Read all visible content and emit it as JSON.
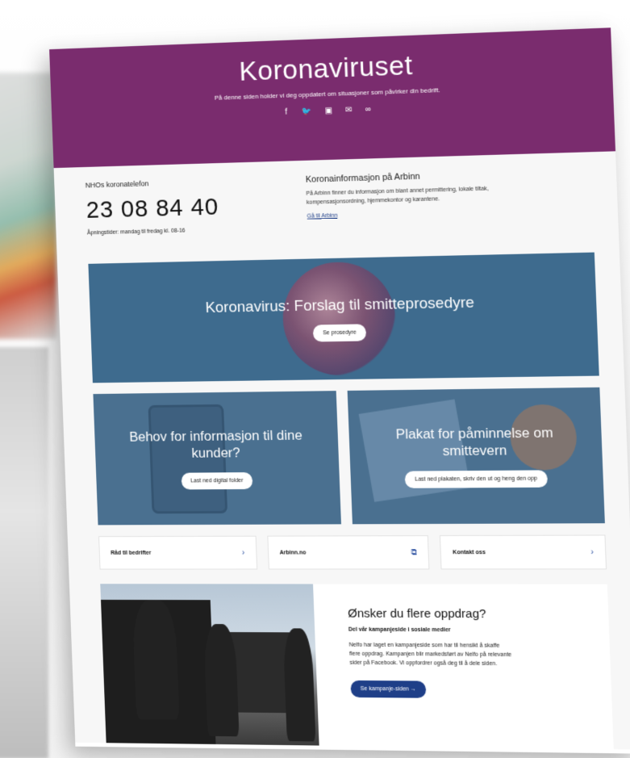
{
  "hero": {
    "title": "Koronaviruset",
    "subtitle": "På denne siden holder vi deg oppdatert om situasjoner som påvirker din bedrift.",
    "share_icons": [
      "facebook-icon",
      "twitter-icon",
      "linkedin-icon",
      "mail-icon",
      "link-icon"
    ],
    "share_glyphs": [
      "f",
      "🐦",
      "▣",
      "✉",
      "∞"
    ]
  },
  "info": {
    "phone_label": "NHOs koronatelefon",
    "phone_number": "23 08 84 40",
    "hours": "Åpningstider: mandag til fredag kl. 08-16",
    "arbinn_title": "Koronainformasjon på Arbinn",
    "arbinn_desc": "På Arbinn finner du informasjon om blant annet permittering, lokale tiltak, kompensasjonsordning, hjemmekontor og karantene.",
    "arbinn_link": "Gå til Arbinn"
  },
  "banner": {
    "title": "Koronavirus: Forslag til smitteprosedyre",
    "button": "Se prosedyre"
  },
  "cards": [
    {
      "title": "Behov for informasjon til dine kunder?",
      "button": "Last ned digital folder"
    },
    {
      "title": "Plakat for påminnelse om smittevern",
      "button": "Last ned plakaten, skriv den ut og heng den opp"
    }
  ],
  "links": [
    {
      "label": "Råd til bedrifter",
      "icon": "chevron-right-icon",
      "glyph": "›"
    },
    {
      "label": "Arbinn.no",
      "icon": "external-link-icon",
      "glyph": "⧉"
    },
    {
      "label": "Kontakt oss",
      "icon": "chevron-right-icon",
      "glyph": "›"
    }
  ],
  "campaign": {
    "title": "Ønsker du flere oppdrag?",
    "subtitle": "Del vår kampanjeside i sosiale medier",
    "body": "Nelfo har laget en kampanjeside som har til hensikt å skaffe flere oppdrag. Kampanjen blir markedsført av Nelfo på relevante sider på Facebook. Vi oppfordrer også deg til å dele siden.",
    "button": "Se kampanje-siden  →"
  },
  "colors": {
    "hero": "#7a2c6e",
    "banner": "#3e6b8e",
    "cta": "#1f3f88"
  }
}
